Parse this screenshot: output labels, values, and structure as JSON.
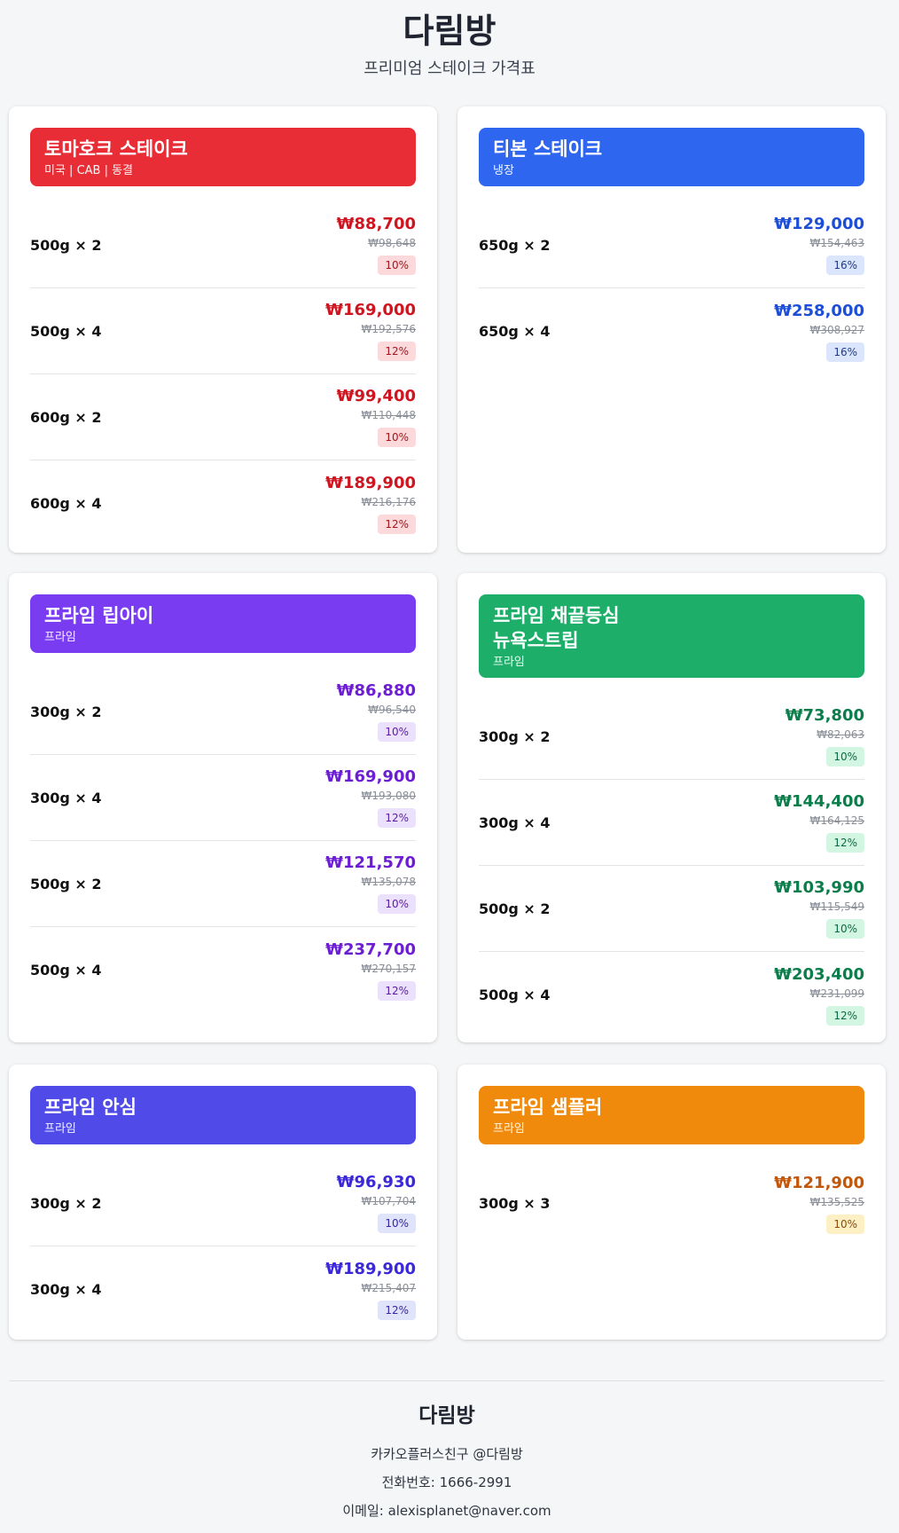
{
  "header": {
    "title": "다림방",
    "subtitle": "프리미엄 스테이크 가격표"
  },
  "colors": {
    "red": "#e82d36",
    "blue": "#2f66f0",
    "purple": "#7a3cf0",
    "green": "#1daf6a",
    "indigo": "#4f4ae8",
    "orange": "#f08a0c"
  },
  "cards": [
    {
      "name": "토마호크 스테이크",
      "sub": "미국 | CAB | 동결",
      "rows": [
        {
          "label": "500g × 2",
          "price": "₩88,700",
          "orig": "₩98,648",
          "discount": "10%"
        },
        {
          "label": "500g × 4",
          "price": "₩169,000",
          "orig": "₩192,576",
          "discount": "12%"
        },
        {
          "label": "600g × 2",
          "price": "₩99,400",
          "orig": "₩110,448",
          "discount": "10%"
        },
        {
          "label": "600g × 4",
          "price": "₩189,900",
          "orig": "₩216,176",
          "discount": "12%"
        }
      ]
    },
    {
      "name": "티본 스테이크",
      "sub": "냉장",
      "rows": [
        {
          "label": "650g × 2",
          "price": "₩129,000",
          "orig": "₩154,463",
          "discount": "16%"
        },
        {
          "label": "650g × 4",
          "price": "₩258,000",
          "orig": "₩308,927",
          "discount": "16%"
        }
      ]
    },
    {
      "name": "프라임 립아이",
      "sub": "프라임",
      "rows": [
        {
          "label": "300g × 2",
          "price": "₩86,880",
          "orig": "₩96,540",
          "discount": "10%"
        },
        {
          "label": "300g × 4",
          "price": "₩169,900",
          "orig": "₩193,080",
          "discount": "12%"
        },
        {
          "label": "500g × 2",
          "price": "₩121,570",
          "orig": "₩135,078",
          "discount": "10%"
        },
        {
          "label": "500g × 4",
          "price": "₩237,700",
          "orig": "₩270,157",
          "discount": "12%"
        }
      ]
    },
    {
      "name": "프라임 채끝등심",
      "name2": "뉴욕스트립",
      "sub": "프라임",
      "rows": [
        {
          "label": "300g × 2",
          "price": "₩73,800",
          "orig": "₩82,063",
          "discount": "10%"
        },
        {
          "label": "300g × 4",
          "price": "₩144,400",
          "orig": "₩164,125",
          "discount": "12%"
        },
        {
          "label": "500g × 2",
          "price": "₩103,990",
          "orig": "₩115,549",
          "discount": "10%"
        },
        {
          "label": "500g × 4",
          "price": "₩203,400",
          "orig": "₩231,099",
          "discount": "12%"
        }
      ]
    },
    {
      "name": "프라임 안심",
      "sub": "프라임",
      "rows": [
        {
          "label": "300g × 2",
          "price": "₩96,930",
          "orig": "₩107,704",
          "discount": "10%"
        },
        {
          "label": "300g × 4",
          "price": "₩189,900",
          "orig": "₩215,407",
          "discount": "12%"
        }
      ]
    },
    {
      "name": "프라임 샘플러",
      "sub": "프라임",
      "rows": [
        {
          "label": "300g × 3",
          "price": "₩121,900",
          "orig": "₩135,525",
          "discount": "10%"
        }
      ]
    }
  ],
  "footer": {
    "title": "다림방",
    "kakao": "카카오플러스친구 @다림방",
    "phone": "전화번호: 1666-2991",
    "email": "이메일: alexisplanet@naver.com"
  }
}
